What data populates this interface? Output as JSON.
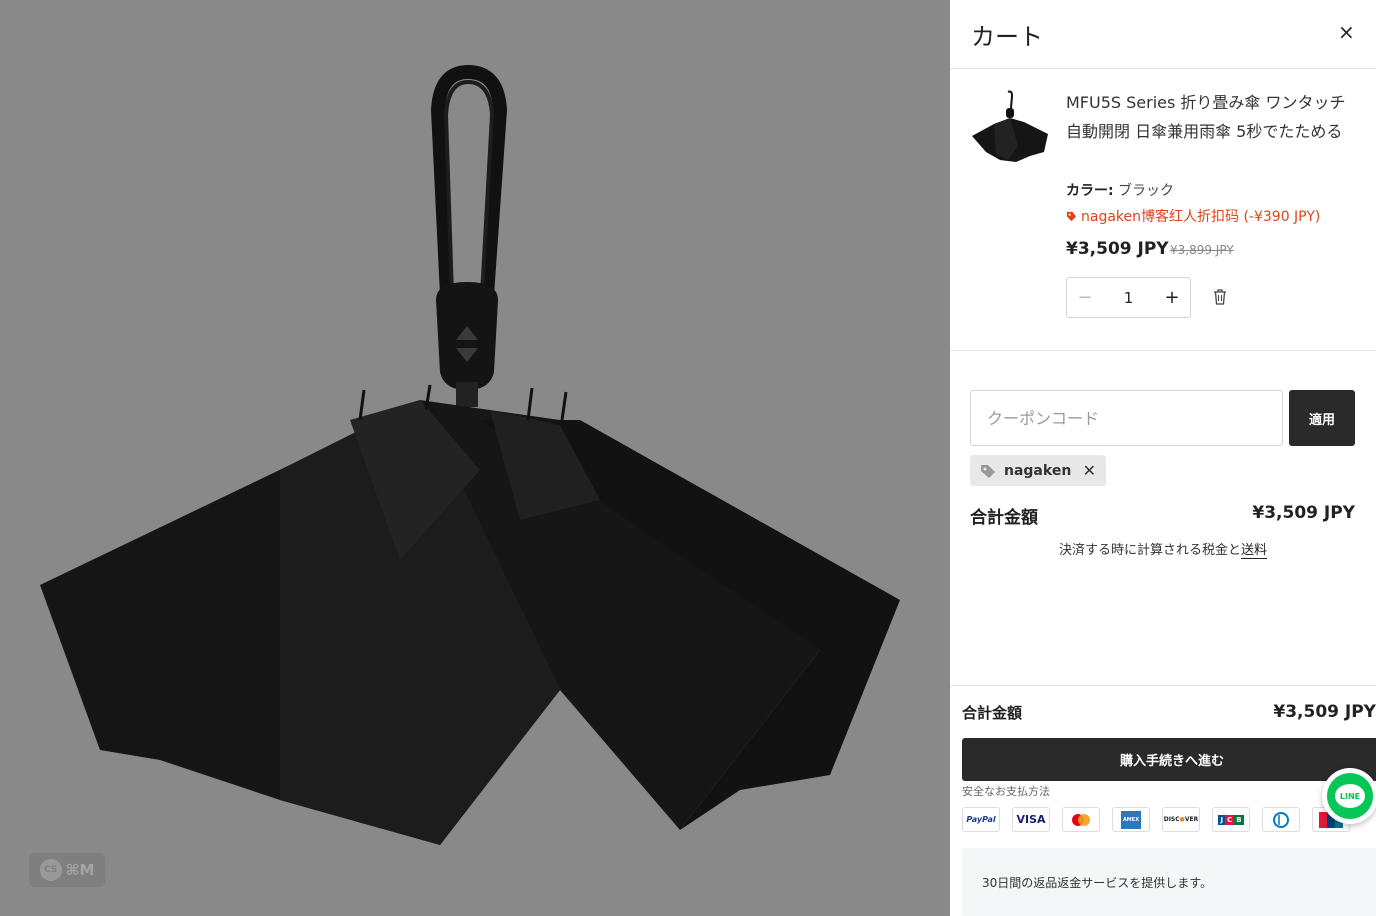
{
  "watermark": {
    "logo_text": "CS",
    "shortcut": "⌘M"
  },
  "cart": {
    "title": "カート",
    "close_icon": "close-icon"
  },
  "item": {
    "title": "MFU5S Series 折り畳み傘 ワンタッチ自動開閉 日傘兼用雨傘 5秒でたためる",
    "variant_label": "カラー:",
    "variant_value": "ブラック",
    "discount_text": "nagaken博客红人折扣码 (-¥390 JPY)",
    "price": "¥3,509 JPY",
    "compare_price": "¥3,899 JPY",
    "quantity": "1",
    "accent_color": "#e0431b"
  },
  "coupon": {
    "placeholder": "クーポンコード",
    "apply_label": "適用",
    "applied_code": "nagaken"
  },
  "summary": {
    "subtotal_label": "合計金額",
    "subtotal_value": "¥3,509 JPY",
    "tax_note": "決済する時に計算される税金と",
    "shipping_link": "送料"
  },
  "footer": {
    "total_label": "合計金額",
    "total_value": "¥3,509 JPY",
    "checkout_label": "購入手続きへ進む",
    "secure_label": "安全なお支払方法",
    "payment_methods": [
      "PayPal",
      "VISA",
      "Mastercard",
      "AMEX",
      "DISCOVER",
      "JCB",
      "Diners",
      "UnionPay"
    ],
    "refund_note": "30日間の返品返金サービスを提供します。"
  },
  "chat": {
    "label": "LINE"
  }
}
